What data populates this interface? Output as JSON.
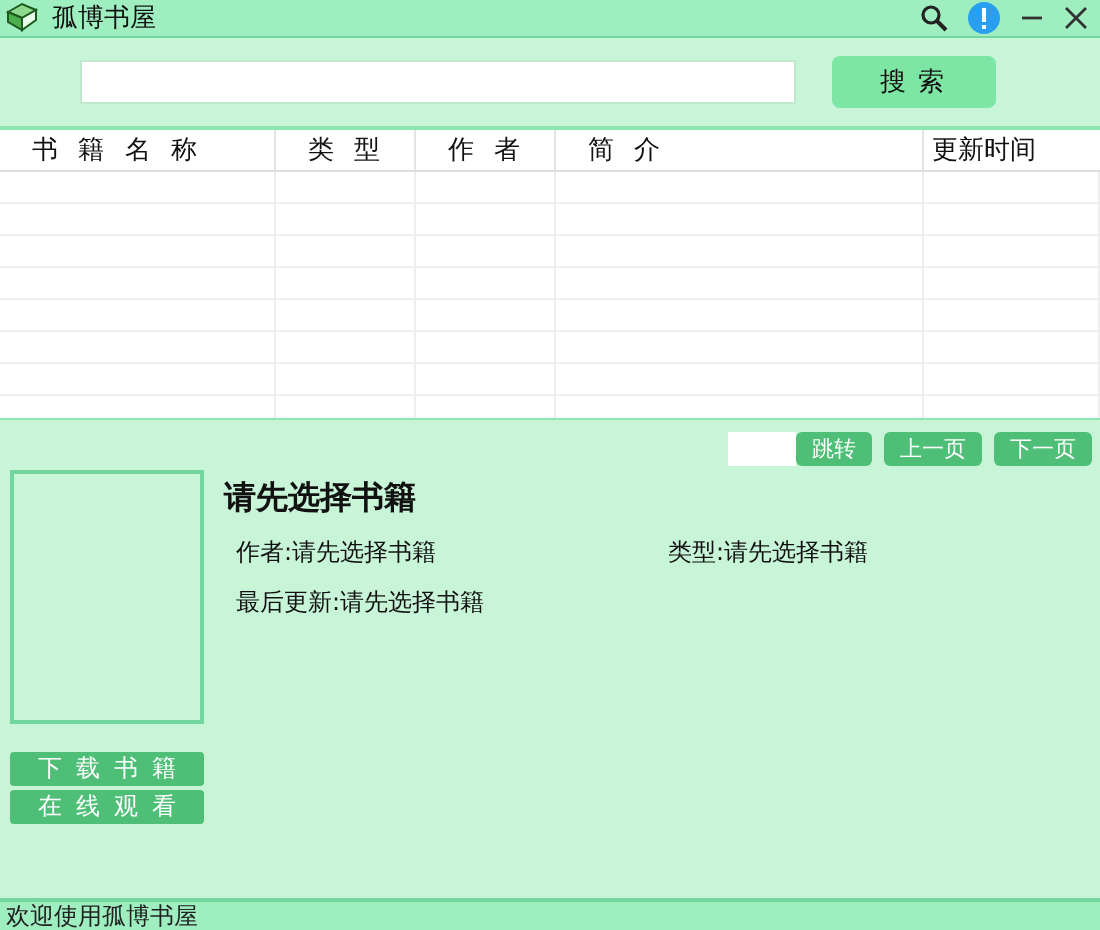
{
  "window": {
    "title": "孤博书屋"
  },
  "search": {
    "button": "搜索"
  },
  "table": {
    "columns": [
      "书 籍 名 称",
      "类 型",
      "作 者",
      "简 介",
      "更新时间"
    ]
  },
  "pager": {
    "jump": {
      "label": "跳转",
      "disabled": true
    },
    "prev": {
      "label": "上一页",
      "disabled": true
    },
    "next": {
      "label": "下一页",
      "disabled": true
    }
  },
  "detail": {
    "title": "请先选择书籍",
    "author": "作者:请先选择书籍",
    "type": "类型:请先选择书籍",
    "updated": "最后更新:请先选择书籍"
  },
  "actions": [
    {
      "label": "下载书籍",
      "disabled": true
    },
    {
      "label": "在线观看",
      "disabled": true
    }
  ],
  "status_bar": "欢迎使用孤博书屋"
}
